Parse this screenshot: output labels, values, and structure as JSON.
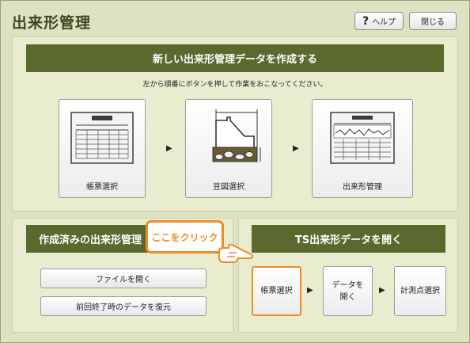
{
  "window": {
    "title": "出来形管理",
    "help_label": "ヘルプ",
    "close_label": "閉じる"
  },
  "create_section": {
    "banner": "新しい出来形管理データを作成する",
    "instruction": "左から順番にボタンを押して作業をおこなってください。",
    "steps": [
      {
        "label": "帳票選択",
        "icon": "form-sheet-icon"
      },
      {
        "label": "豆図選択",
        "icon": "cross-section-diagram-icon"
      },
      {
        "label": "出来形管理",
        "icon": "chart-sheet-icon"
      }
    ],
    "arrow": "▶"
  },
  "existing_section": {
    "banner": "作成済みの出来形管理",
    "open_file": "ファイルを開く",
    "restore": "前回終了時のデータを復元"
  },
  "ts_section": {
    "banner": "TS出来形データを開く",
    "buttons": [
      "帳票選択",
      "データを\n開く",
      "計測点選択"
    ],
    "arrow": "▶"
  },
  "callout": {
    "text": "ここをクリック",
    "color": "#f08a24"
  }
}
